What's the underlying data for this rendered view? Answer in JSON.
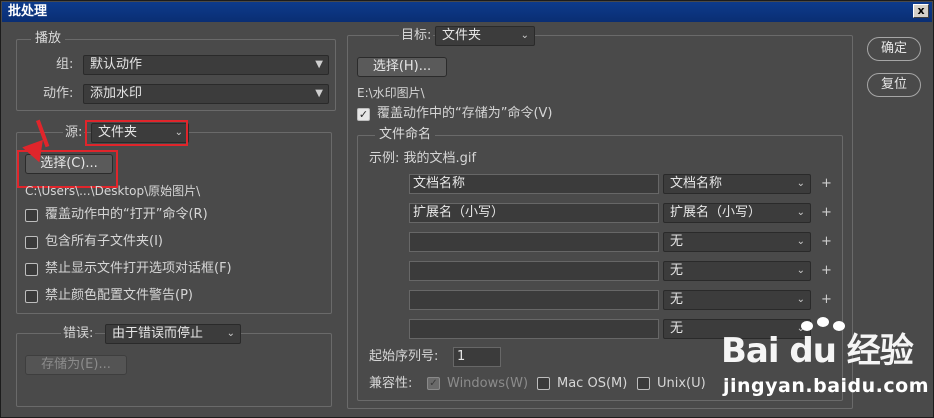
{
  "window": {
    "title": "批处理",
    "close_label": "x"
  },
  "play": {
    "legend": "播放",
    "group_label": "组:",
    "group_value": "默认动作",
    "action_label": "动作:",
    "action_value": "添加水印"
  },
  "source": {
    "label": "源:",
    "value": "文件夹",
    "choose_label": "选择(C)...",
    "path": "C:\\Users\\...\\Desktop\\原始图片\\",
    "options": [
      {
        "label": "覆盖动作中的“打开”命令(R)",
        "checked": false
      },
      {
        "label": "包含所有子文件夹(I)",
        "checked": false
      },
      {
        "label": "禁止显示文件打开选项对话框(F)",
        "checked": false
      },
      {
        "label": "禁止颜色配置文件警告(P)",
        "checked": false
      }
    ]
  },
  "errors": {
    "label": "错误:",
    "value": "由于错误而停止",
    "save_as_label": "存储为(E)..."
  },
  "destination": {
    "label": "目标:",
    "value": "文件夹",
    "choose_label": "选择(H)...",
    "path": "E:\\水印图片\\",
    "override_save": {
      "label": "覆盖动作中的“存储为”命令(V)",
      "checked": true
    }
  },
  "naming": {
    "legend": "文件命名",
    "example": "示例: 我的文档.gif",
    "rows": [
      {
        "text": "文档名称",
        "select": "文档名称",
        "plus": true
      },
      {
        "text": "扩展名（小写）",
        "select": "扩展名（小写）",
        "plus": true
      },
      {
        "text": "",
        "select": "无",
        "plus": true
      },
      {
        "text": "",
        "select": "无",
        "plus": true
      },
      {
        "text": "",
        "select": "无",
        "plus": true
      },
      {
        "text": "",
        "select": "无",
        "plus": false
      }
    ],
    "plus_symbol": "+",
    "serial_label": "起始序列号:",
    "serial_value": "1",
    "compat_label": "兼容性:",
    "compat": [
      {
        "label": "Windows(W)",
        "checked": true,
        "disabled": true
      },
      {
        "label": "Mac OS(M)",
        "checked": false,
        "disabled": false
      },
      {
        "label": "Unix(U)",
        "checked": false,
        "disabled": false
      }
    ]
  },
  "buttons": {
    "ok": "确定",
    "reset": "复位"
  },
  "watermark": {
    "logo": "Bai du 经验",
    "site": "jingyan.baidu.com"
  },
  "colors": {
    "highlight": "#e0252b",
    "panel": "#4a4a4a",
    "title_bar": "#0a2e73"
  }
}
